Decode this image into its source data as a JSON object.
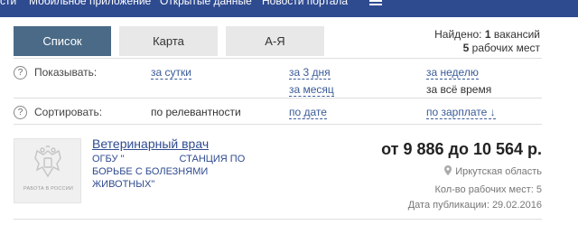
{
  "topnav": {
    "items": [
      "сти",
      "Мобильное приложение",
      "Открытые данные",
      "Новости портала"
    ]
  },
  "tabs": {
    "list": "Список",
    "map": "Карта",
    "az": "А-Я"
  },
  "found": {
    "prefix": "Найдено:",
    "vacancies_count": "1",
    "vacancies_label": "вакансий",
    "workplaces_count": "5",
    "workplaces_label": "рабочих мест"
  },
  "filters": {
    "show_label": "Показывать:",
    "show_options": [
      "за сутки",
      "за 3 дня",
      "за неделю",
      "за месяц",
      "за всё время"
    ],
    "sort_label": "Сортировать:",
    "sort_options": [
      "по релевантности",
      "по дате",
      "по зарплате ↓"
    ],
    "help_glyph": "?"
  },
  "vacancy": {
    "title": "Ветеринарный врач",
    "org_line1": "ОГБУ \"                    СТАНЦИЯ ПО",
    "org_line2": "БОРЬБЕ С БОЛЕЗНЯМИ",
    "org_line3": "ЖИВОТНЫХ\"",
    "salary": "от 9 886 до 10 564 р.",
    "region": "Иркутская область",
    "workplaces": "Кол-во рабочих мест: 5",
    "pubdate": "Дата публикации: 29.02.2016",
    "logo_text": "РАБОТА В РОССИИ"
  },
  "colors": {
    "topbar": "#2f4b90",
    "tab_active": "#4a6a87",
    "tab_inactive": "#e8e8e8",
    "link": "#3a5b98"
  }
}
